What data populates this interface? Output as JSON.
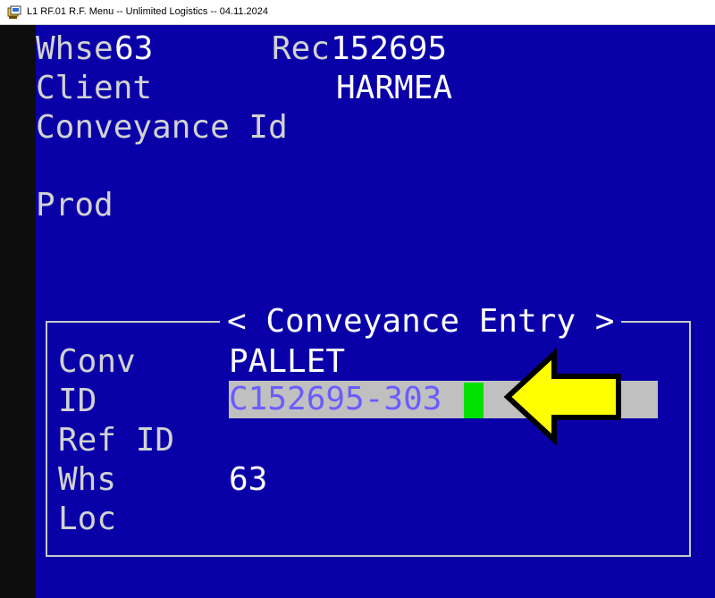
{
  "window": {
    "title": "L1 RF.01 R.F. Menu -- Unlimited Logistics -- 04.11.2024",
    "icon": "terminal-app-icon"
  },
  "header": {
    "whse_label": "Whse",
    "whse_value": "63",
    "rec_label": "Rec",
    "rec_value": "152695",
    "client_label": "Client",
    "client_value": "HARMEA",
    "conveyance_id_label": "Conveyance Id",
    "prod_label": "Prod"
  },
  "dialog": {
    "title": "< Conveyance Entry >",
    "conv_label": "Conv",
    "conv_value": "PALLET",
    "id_label": "ID",
    "id_value": "C152695-303",
    "ref_id_label": "Ref ID",
    "whs_label": "Whs",
    "whs_value": "63",
    "loc_label": "Loc"
  },
  "annotation": {
    "arrow_icon": "arrow-left-icon",
    "arrow_color": "#ffff00"
  },
  "colors": {
    "screen_bg": "#0a00a8",
    "label_text": "#d2d2d2",
    "value_text": "#ffffff",
    "field_bg": "#c0c0c0",
    "field_text": "#6b5cff",
    "cursor": "#00e100"
  }
}
